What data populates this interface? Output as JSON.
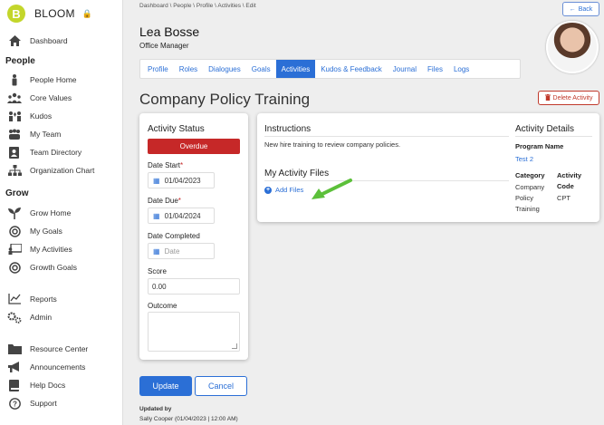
{
  "brand": {
    "logo_letter": "B",
    "name": "BLOOM",
    "lock_icon": "lock-icon"
  },
  "sidebar": {
    "dashboard": {
      "label": "Dashboard",
      "icon": "home-icon"
    },
    "people_heading": "People",
    "people_items": [
      {
        "label": "People Home",
        "icon": "person-icon"
      },
      {
        "label": "Core Values",
        "icon": "people-group-icon"
      },
      {
        "label": "Kudos",
        "icon": "kudos-icon"
      },
      {
        "label": "My Team",
        "icon": "team-icon"
      },
      {
        "label": "Team Directory",
        "icon": "address-book-icon"
      },
      {
        "label": "Organization Chart",
        "icon": "org-chart-icon"
      }
    ],
    "grow_heading": "Grow",
    "grow_items": [
      {
        "label": "Grow Home",
        "icon": "seedling-icon"
      },
      {
        "label": "My Goals",
        "icon": "target-icon"
      },
      {
        "label": "My Activities",
        "icon": "presentation-icon"
      },
      {
        "label": "Growth Goals",
        "icon": "target-icon"
      }
    ],
    "other_items": [
      {
        "label": "Reports",
        "icon": "line-chart-icon"
      },
      {
        "label": "Admin",
        "icon": "gears-icon"
      }
    ],
    "bottom_items": [
      {
        "label": "Resource Center",
        "icon": "folder-icon"
      },
      {
        "label": "Announcements",
        "icon": "megaphone-icon"
      },
      {
        "label": "Help Docs",
        "icon": "book-icon"
      },
      {
        "label": "Support",
        "icon": "question-circle-icon"
      }
    ]
  },
  "header": {
    "breadcrumb": "Dashboard \\ People \\ Profile \\ Activities \\ Edit",
    "back_label": "Back",
    "person_name": "Lea Bosse",
    "person_title": "Office Manager"
  },
  "tabs": [
    {
      "label": "Profile",
      "active": false
    },
    {
      "label": "Roles",
      "active": false
    },
    {
      "label": "Dialogues",
      "active": false
    },
    {
      "label": "Goals",
      "active": false
    },
    {
      "label": "Activities",
      "active": true
    },
    {
      "label": "Kudos & Feedback",
      "active": false
    },
    {
      "label": "Journal",
      "active": false
    },
    {
      "label": "Files",
      "active": false
    },
    {
      "label": "Logs",
      "active": false
    }
  ],
  "page": {
    "heading": "Company Policy Training",
    "delete_label": "Delete Activity"
  },
  "status": {
    "title": "Activity Status",
    "badge": "Overdue",
    "badge_color": "#c62828",
    "date_start_label": "Date Start",
    "date_start_value": "01/04/2023",
    "date_due_label": "Date Due",
    "date_due_value": "01/04/2024",
    "date_completed_label": "Date Completed",
    "date_completed_placeholder": "Date",
    "score_label": "Score",
    "score_value": "0.00",
    "outcome_label": "Outcome",
    "required_mark": "*"
  },
  "instructions": {
    "title": "Instructions",
    "text": "New hire training to review company policies.",
    "files_title": "My Activity Files",
    "add_files_label": "Add Files"
  },
  "details": {
    "title": "Activity Details",
    "program_label": "Program Name",
    "program_value": "Test 2",
    "category_label": "Category",
    "category_value_lines": [
      "Company",
      "Policy",
      "Training"
    ],
    "code_label_lines": [
      "Activity",
      "Code"
    ],
    "code_value": "CPT"
  },
  "footer": {
    "update_label": "Update",
    "cancel_label": "Cancel",
    "updated_by_label": "Updated by",
    "updated_by_value": "Sally Cooper  (01/04/2023 | 12:00 AM)"
  },
  "colors": {
    "accent": "#2b6fd6",
    "brand": "#c3d62b",
    "danger": "#c62828"
  }
}
